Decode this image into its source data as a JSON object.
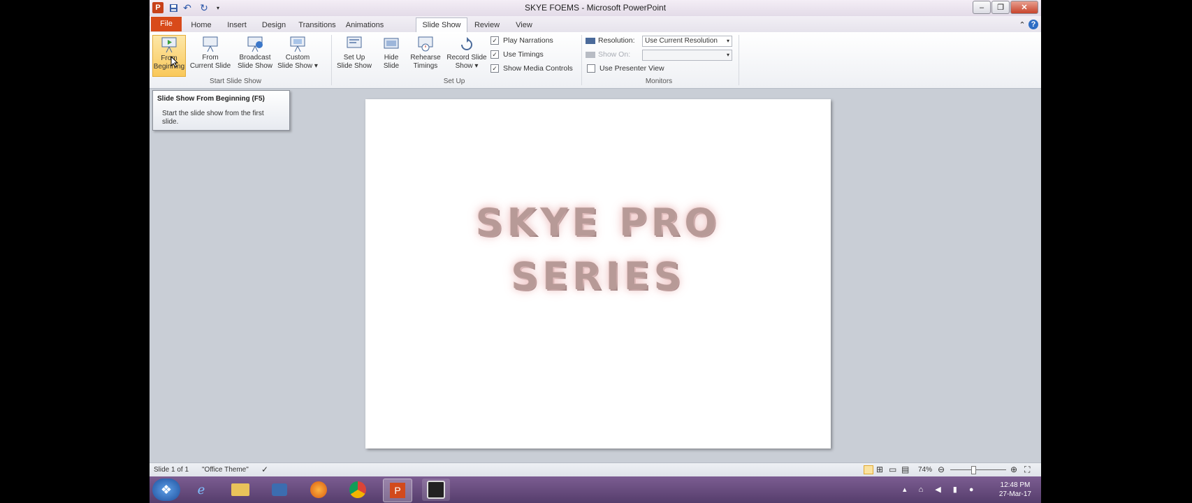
{
  "window": {
    "title": "SKYE FOEMS - Microsoft PowerPoint",
    "app_icon": "P",
    "quick_access": [
      "save-icon",
      "undo-icon",
      "redo-icon",
      "customize-icon"
    ],
    "controls": [
      "minimize-icon",
      "restore-icon",
      "close-icon"
    ]
  },
  "menu": {
    "file": "File",
    "tabs": [
      "Home",
      "Insert",
      "Design",
      "Transitions",
      "Animations",
      "Slide Show",
      "Review",
      "View"
    ],
    "active_tab": "Slide Show"
  },
  "ribbon": {
    "start_group": {
      "label": "Start Slide Show",
      "buttons": [
        {
          "line1": "From",
          "line2": "Beginning"
        },
        {
          "line1": "From",
          "line2": "Current Slide"
        },
        {
          "line1": "Broadcast",
          "line2": "Slide Show"
        },
        {
          "line1": "Custom",
          "line2": "Slide Show ▾"
        }
      ]
    },
    "setup_group": {
      "label": "Set Up",
      "buttons": [
        {
          "line1": "Set Up",
          "line2": "Slide Show"
        },
        {
          "line1": "Hide",
          "line2": "Slide"
        },
        {
          "line1": "Rehearse",
          "line2": "Timings"
        },
        {
          "line1": "Record Slide",
          "line2": "Show ▾"
        }
      ],
      "checks": [
        {
          "label": "Play Narrations",
          "checked": true
        },
        {
          "label": "Use Timings",
          "checked": true
        },
        {
          "label": "Show Media Controls",
          "checked": true
        }
      ]
    },
    "monitors_group": {
      "label": "Monitors",
      "resolution_label": "Resolution:",
      "resolution_value": "Use Current Resolution",
      "show_on_label": "Show On:",
      "presenter_view": "Use Presenter View"
    }
  },
  "tooltip": {
    "title": "Slide Show From Beginning (F5)",
    "body": "Start the slide show from the first slide."
  },
  "slide": {
    "line1": "SKYE PRO",
    "line2": "SERIES"
  },
  "status": {
    "slide_info": "Slide 1 of 1",
    "theme": "\"Office Theme\"",
    "zoom": "74%"
  },
  "taskbar": {
    "time": "12:48 PM",
    "date": "27-Mar-17"
  },
  "colors": {
    "file_tab": "#d84a1a",
    "taskbar": "#6b4f83",
    "workspace": "#c9ced6"
  }
}
